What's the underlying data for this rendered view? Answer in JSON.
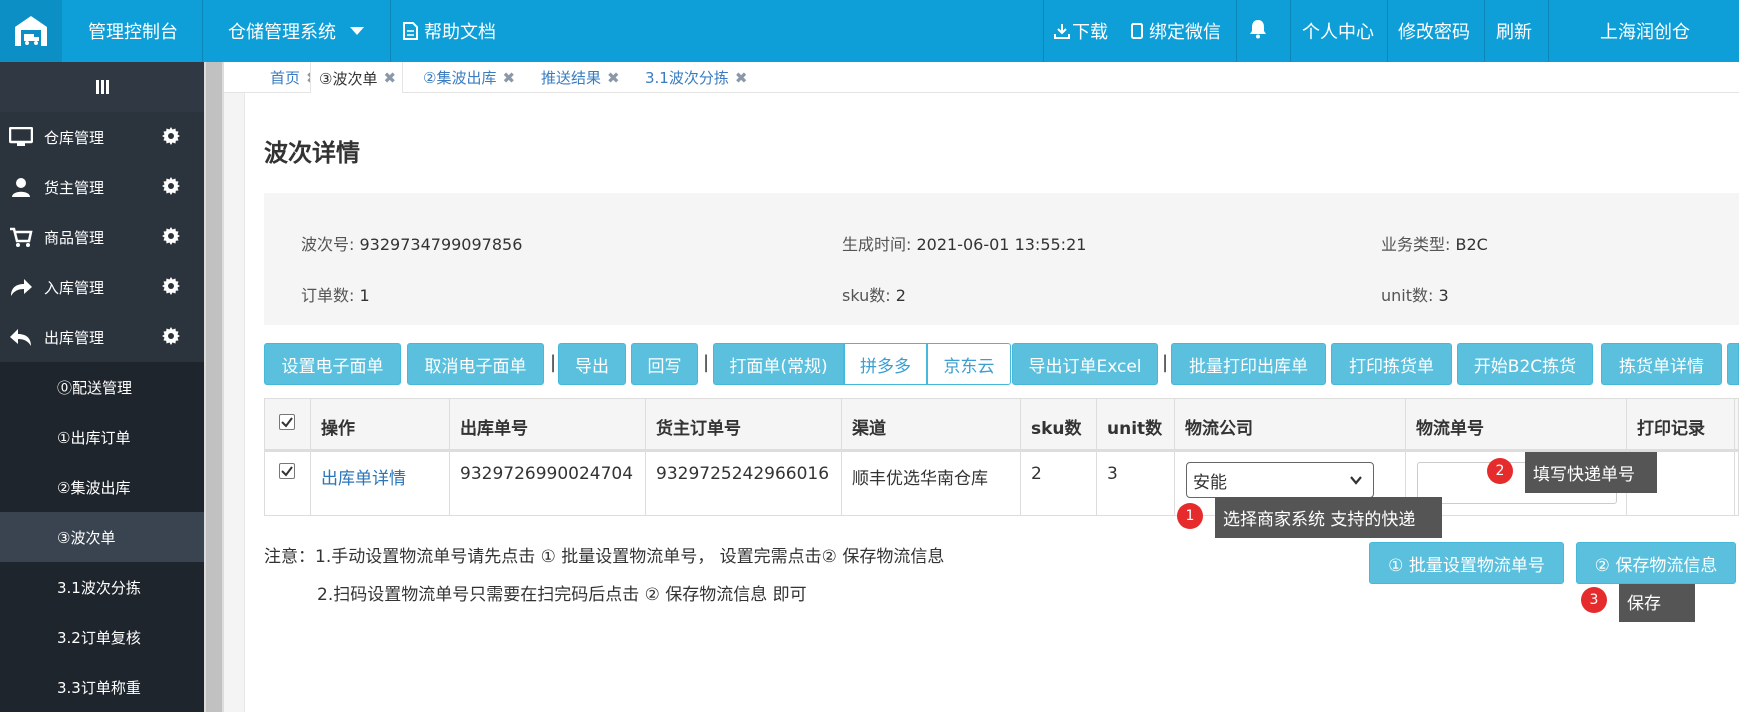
{
  "topbar": {
    "console": "管理控制台",
    "system": "仓储管理系统",
    "help": "帮助文档",
    "download": "下载",
    "bind_wechat": "绑定微信",
    "profile": "个人中心",
    "change_password": "修改密码",
    "refresh": "刷新",
    "company": "上海润创仓"
  },
  "sidebar": {
    "items": [
      {
        "label": "仓库管理",
        "icon": "monitor-icon"
      },
      {
        "label": "货主管理",
        "icon": "user-icon"
      },
      {
        "label": "商品管理",
        "icon": "cart-icon"
      },
      {
        "label": "入库管理",
        "icon": "share-icon"
      },
      {
        "label": "出库管理",
        "icon": "reply-icon"
      }
    ],
    "subitems": [
      {
        "label": "⓪配送管理"
      },
      {
        "label": "①出库订单"
      },
      {
        "label": "②集波出库"
      },
      {
        "label": "③波次单"
      },
      {
        "label": "3.1波次分拣"
      },
      {
        "label": "3.2订单复核"
      },
      {
        "label": "3.3订单称重"
      }
    ]
  },
  "tabs": [
    {
      "label": "首页"
    },
    {
      "label": "③波次单"
    },
    {
      "label": "②集波出库"
    },
    {
      "label": "推送结果"
    },
    {
      "label": "3.1波次分拣"
    }
  ],
  "page": {
    "title": "波次详情"
  },
  "info": {
    "wave_no_label": "波次号:",
    "wave_no": "9329734799097856",
    "created_label": "生成时间:",
    "created": "2021-06-01 13:55:21",
    "biz_type_label": "业务类型:",
    "biz_type": "B2C",
    "order_count_label": "订单数:",
    "order_count": "1",
    "sku_label": "sku数:",
    "sku": "2",
    "unit_label": "unit数:",
    "unit": "3"
  },
  "toolbar": {
    "set_eface": "设置电子面单",
    "cancel_eface": "取消电子面单",
    "export": "导出",
    "writeback": "回写",
    "print_normal": "打面单(常规)",
    "pdd": "拼多多",
    "jdcloud": "京东云",
    "export_excel": "导出订单Excel",
    "batch_print": "批量打印出库单",
    "print_pick": "打印拣货单",
    "start_b2c": "开始B2C拣货",
    "pick_detail": "拣货单详情",
    "sep": "|"
  },
  "table": {
    "headers": [
      "操作",
      "出库单号",
      "货主订单号",
      "渠道",
      "sku数",
      "unit数",
      "物流公司",
      "物流单号",
      "打印记录"
    ],
    "rows": [
      {
        "action": "出库单详情",
        "outbound_no": "9329726990024704",
        "owner_order_no": "9329725242966016",
        "channel": "顺丰优选华南仓库",
        "sku": "2",
        "unit": "3",
        "logistics": "安能",
        "tracking_no": ""
      }
    ]
  },
  "annotations": {
    "a1_num": "1",
    "a1_text": "选择商家系统 支持的快递",
    "a2_num": "2",
    "a2_text": "填写快递单号",
    "a3_num": "3",
    "a3_text": "保存"
  },
  "notes": {
    "line1": "注意：1.手动设置物流单号请先点击 ① 批量设置物流单号， 设置完需点击② 保存物流信息",
    "line2": "2.扫码设置物流单号只需要在扫完码后点击 ② 保存物流信息 即可"
  },
  "bottom_buttons": {
    "batch_set": "① 批量设置物流单号",
    "save_logistics": "② 保存物流信息"
  },
  "colors": {
    "topbar": "#0e9fd8",
    "sidebar": "#262e37",
    "button": "#5bc0de",
    "badge": "#e52b2b"
  }
}
